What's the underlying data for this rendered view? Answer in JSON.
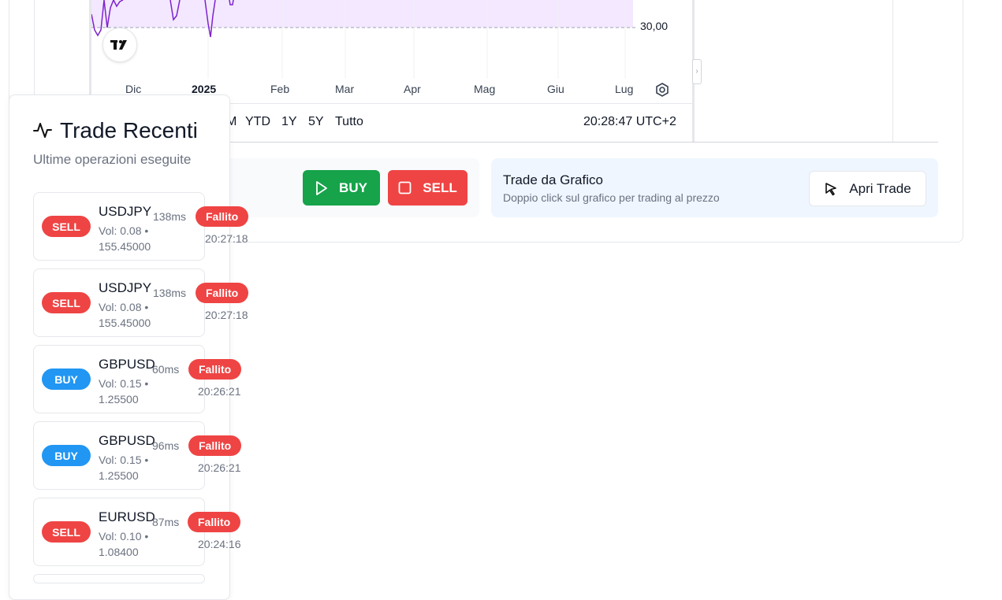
{
  "chart": {
    "price_label": "30,00",
    "logo_text": "TV",
    "x_ticks": [
      {
        "label": "Dic",
        "bold": false
      },
      {
        "label": "2025",
        "bold": true
      },
      {
        "label": "Feb",
        "bold": false
      },
      {
        "label": "Mar",
        "bold": false
      },
      {
        "label": "Apr",
        "bold": false
      },
      {
        "label": "Mag",
        "bold": false
      },
      {
        "label": "Giu",
        "bold": false
      },
      {
        "label": "Lug",
        "bold": false
      }
    ],
    "ranges": [
      "M",
      "YTD",
      "1Y",
      "5Y",
      "Tutto"
    ],
    "clock": "20:28:47 UTC+2",
    "series_color": "#7e22ce",
    "fill_color": "#f3e8ff"
  },
  "actions": {
    "buy_label": "BUY",
    "sell_label": "SELL",
    "buy_color": "#16a34a",
    "sell_color": "#ef4444"
  },
  "chart_trade": {
    "title": "Trade da Grafico",
    "subtitle": "Doppio click sul grafico per trading al prezzo",
    "button_label": "Apri Trade"
  },
  "recent": {
    "title": "Trade Recenti",
    "subtitle": "Ultime operazioni eseguite",
    "trades": [
      {
        "side": "SELL",
        "symbol": "USDJPY",
        "vol": "Vol: 0.08 •",
        "price": "155.45000",
        "latency": "138ms",
        "status": "Fallito",
        "time": "20:27:18"
      },
      {
        "side": "SELL",
        "symbol": "USDJPY",
        "vol": "Vol: 0.08 •",
        "price": "155.45000",
        "latency": "138ms",
        "status": "Fallito",
        "time": "20:27:18"
      },
      {
        "side": "BUY",
        "symbol": "GBPUSD",
        "vol": "Vol: 0.15 •",
        "price": "1.25500",
        "latency": "60ms",
        "status": "Fallito",
        "time": "20:26:21"
      },
      {
        "side": "BUY",
        "symbol": "GBPUSD",
        "vol": "Vol: 0.15 •",
        "price": "1.25500",
        "latency": "96ms",
        "status": "Fallito",
        "time": "20:26:21"
      },
      {
        "side": "SELL",
        "symbol": "EURUSD",
        "vol": "Vol: 0.10 •",
        "price": "1.08400",
        "latency": "87ms",
        "status": "Fallito",
        "time": "20:24:16"
      }
    ]
  }
}
